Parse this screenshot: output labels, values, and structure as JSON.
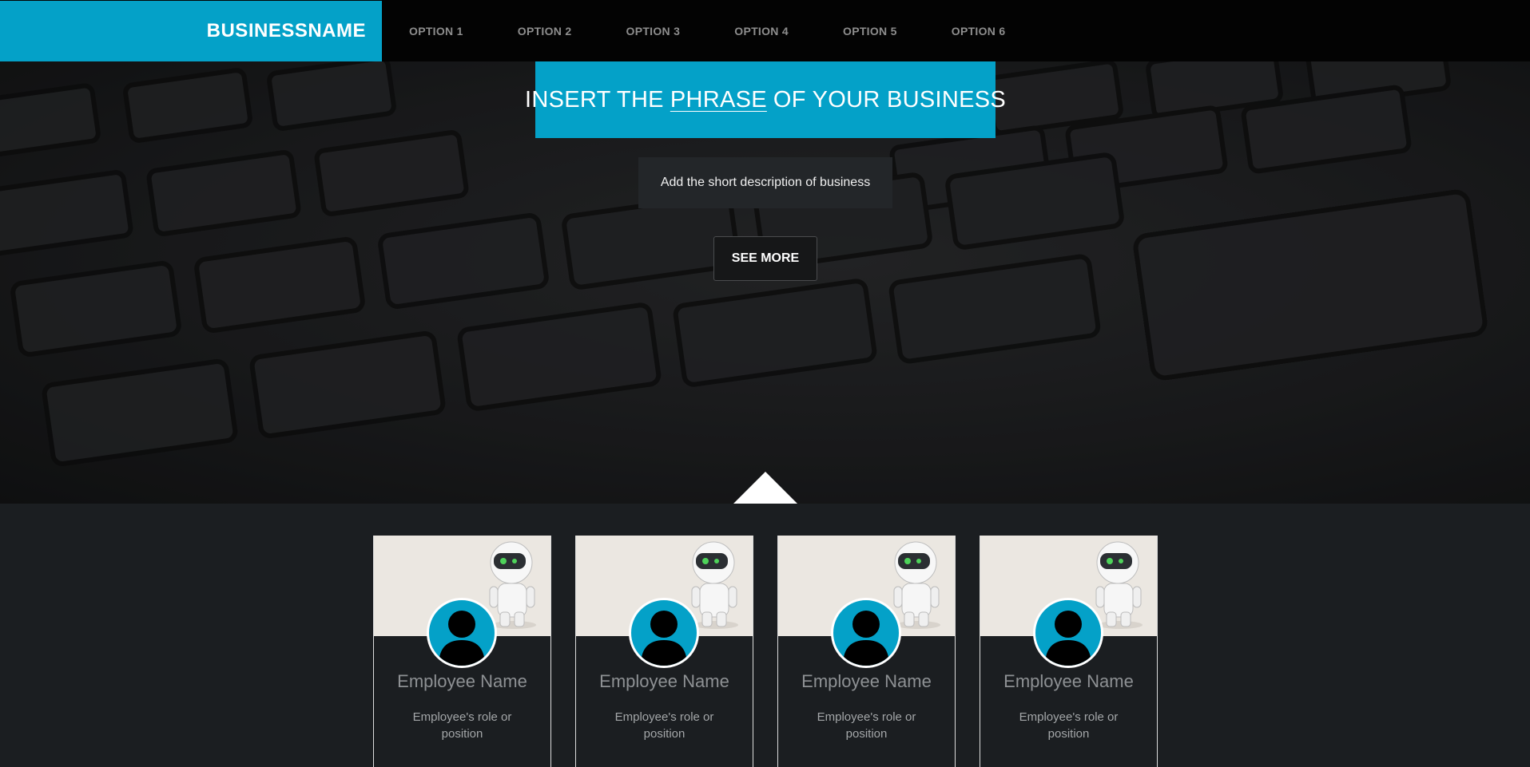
{
  "nav": {
    "brand": "BUSINESSNAME",
    "options": [
      "OPTION 1",
      "OPTION 2",
      "OPTION 3",
      "OPTION 4",
      "OPTION 5",
      "OPTION 6"
    ]
  },
  "hero": {
    "headline_before": "INSERT THE",
    "headline_underlined": "PHRASE",
    "headline_after": "OF YOUR BUSINESS",
    "description": "Add the short description of business",
    "cta": "SEE MORE"
  },
  "team": [
    {
      "name": "Employee Name",
      "role": "Employee's role or position"
    },
    {
      "name": "Employee Name",
      "role": "Employee's role or position"
    },
    {
      "name": "Employee Name",
      "role": "Employee's role or position"
    },
    {
      "name": "Employee Name",
      "role": "Employee's role or position"
    }
  ],
  "colors": {
    "accent": "#04a1c8",
    "navbar": "#030303",
    "page_background": "#1b1e21"
  },
  "icons": {
    "avatar": "user-silhouette-icon",
    "scroll_indicator": "triangle-up-icon"
  }
}
